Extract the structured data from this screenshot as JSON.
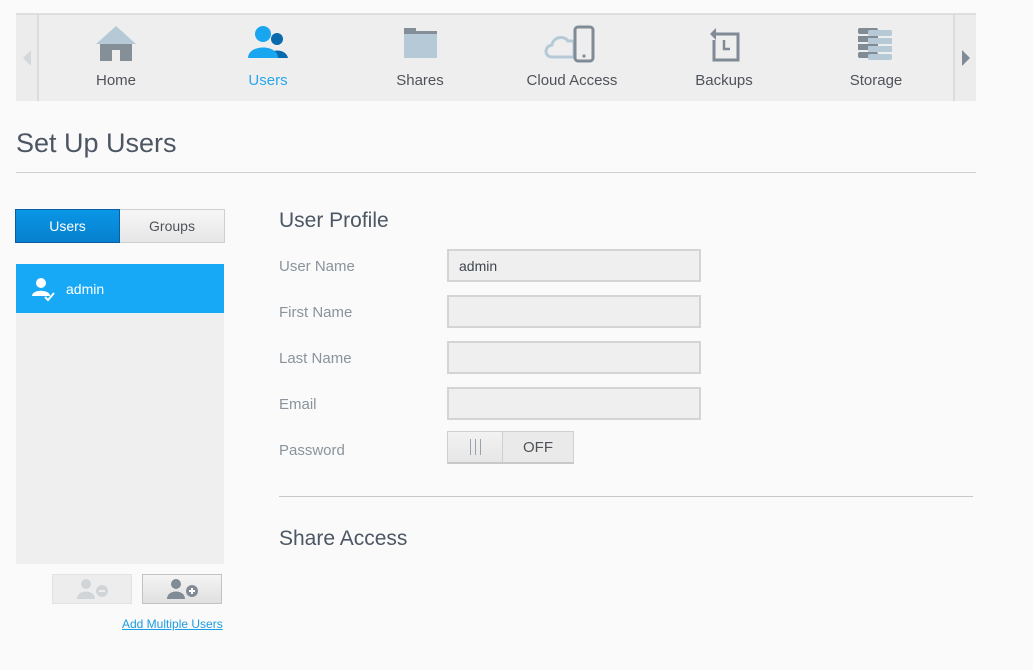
{
  "nav": {
    "prev_icon": "chevron-left-icon",
    "next_icon": "chevron-right-icon",
    "items": [
      {
        "label": "Home",
        "icon": "home-icon",
        "active": false
      },
      {
        "label": "Users",
        "icon": "users-icon",
        "active": true
      },
      {
        "label": "Shares",
        "icon": "folder-icon",
        "active": false
      },
      {
        "label": "Cloud Access",
        "icon": "cloud-device-icon",
        "active": false
      },
      {
        "label": "Backups",
        "icon": "backup-icon",
        "active": false
      },
      {
        "label": "Storage",
        "icon": "storage-icon",
        "active": false
      }
    ]
  },
  "page": {
    "title": "Set Up Users"
  },
  "sidebar": {
    "tabs": [
      {
        "label": "Users",
        "active": true
      },
      {
        "label": "Groups",
        "active": false
      }
    ],
    "users": [
      {
        "name": "admin",
        "icon": "admin-user-icon",
        "selected": true
      }
    ],
    "remove_user_icon": "remove-user-icon",
    "add_user_icon": "add-user-icon",
    "add_multiple_label": "Add Multiple Users"
  },
  "profile": {
    "heading": "User Profile",
    "fields": {
      "user_name": {
        "label": "User Name",
        "value": "admin"
      },
      "first_name": {
        "label": "First Name",
        "value": ""
      },
      "last_name": {
        "label": "Last Name",
        "value": ""
      },
      "email": {
        "label": "Email",
        "value": ""
      }
    },
    "password": {
      "label": "Password",
      "state": "OFF"
    }
  },
  "share_access": {
    "heading": "Share Access"
  },
  "colors": {
    "accent": "#17a9f5",
    "active_tab": "#0a8ddc",
    "link": "#1d9be3"
  }
}
